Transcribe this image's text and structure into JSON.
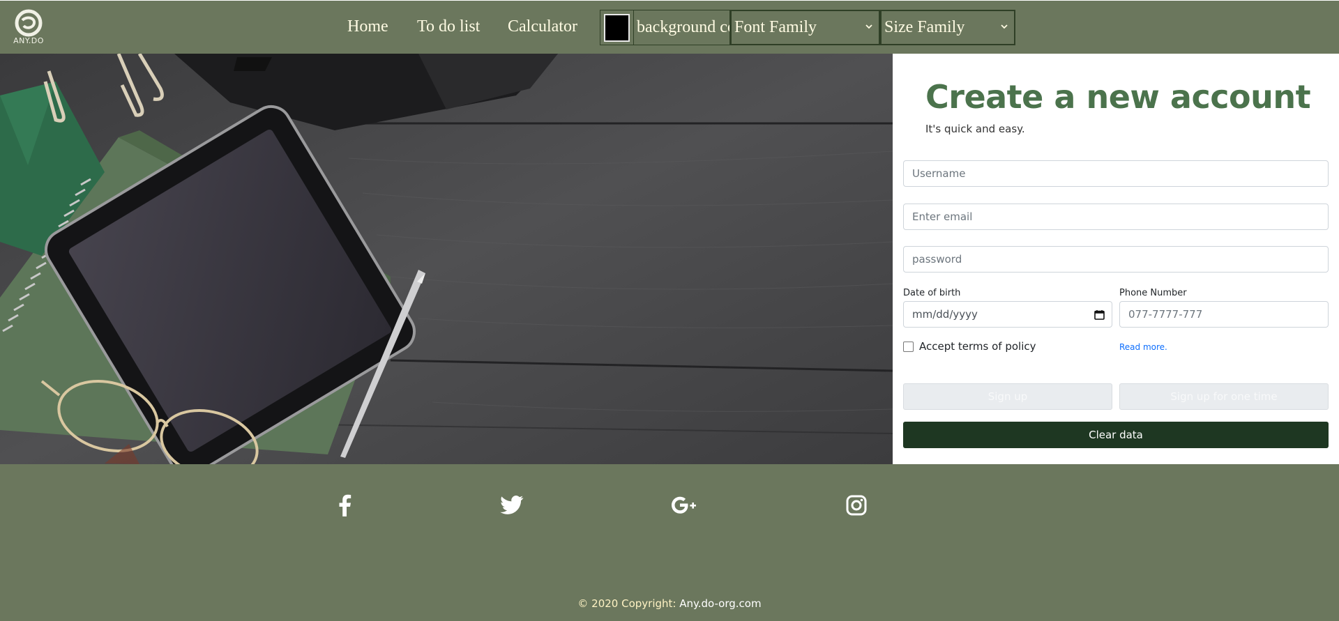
{
  "header": {
    "logo_text": "ANY.DO",
    "nav": [
      {
        "label": "Home"
      },
      {
        "label": "To do list"
      },
      {
        "label": "Calculator"
      }
    ],
    "background_color_label": "background color",
    "background_color_value": "#000000",
    "font_family_select": "Font Family",
    "size_family_select": "Size Family"
  },
  "form": {
    "title": "Create a new account",
    "subtitle": "It's quick and easy.",
    "username_placeholder": "Username",
    "email_placeholder": "Enter email",
    "password_placeholder": "password",
    "dob_label": "Date of birth",
    "dob_placeholder": "mm/dd/yyyy",
    "phone_label": "Phone Number",
    "phone_placeholder": "077-7777-777",
    "terms_label": "Accept terms of policy",
    "read_more": "Read more.",
    "signup_button": "Sign up",
    "signup_once_button": "Sign up  for one time",
    "clear_button": "Clear data"
  },
  "footer": {
    "social": [
      {
        "icon": "facebook-icon"
      },
      {
        "icon": "twitter-icon"
      },
      {
        "icon": "google-plus-icon"
      },
      {
        "icon": "instagram-icon"
      }
    ],
    "copyright_prefix": "© 2020 Copyright: ",
    "copyright_link": "Any.do-org.com"
  },
  "colors": {
    "header_bg": "#6b775d",
    "accent_green": "#4b734c",
    "clear_button_bg": "#1e3722",
    "nav_text": "#fffbe3"
  }
}
